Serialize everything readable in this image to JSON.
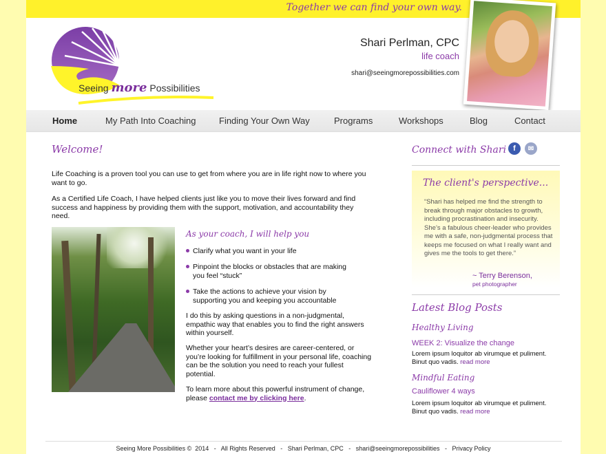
{
  "header": {
    "tagline": "Together we can find your own way.",
    "logo": {
      "word1": "Seeing",
      "word2": "more",
      "word3": "Possibilities"
    },
    "name": "Shari Perlman, CPC",
    "title": "life coach",
    "email": "shari@seeingmorepossibilities.com"
  },
  "nav": {
    "items": [
      {
        "label": "Home",
        "active": true
      },
      {
        "label": "My Path Into Coaching"
      },
      {
        "label": "Finding Your Own Way"
      },
      {
        "label": "Programs"
      },
      {
        "label": "Workshops"
      },
      {
        "label": "Blog"
      },
      {
        "label": "Contact"
      }
    ]
  },
  "main": {
    "heading": "Welcome!",
    "p1": "Life Coaching is a proven tool you can use to get from where you are in life right now to where you want to go.",
    "p2": "As a Certified Life Coach, I have helped clients just like you to move their lives forward and find success and happiness by providing them with the support, motivation, and accountability they need.",
    "coach_heading": "As your coach, I will help you",
    "bullets": [
      "Clarify what you want in your life",
      "Pinpoint the blocks or obstacles that are making you feel “stuck”",
      "Take the actions to achieve your vision by supporting you and keeping you accountable"
    ],
    "p3": "I do this by asking questions in a non-judgmental, empathic way that enables you to find the right answers within yourself.",
    "p4": "Whether your heart’s desires are career-centered, or you’re looking for fulfillment in your personal life, coaching can be the solution you need to reach your fullest potential.",
    "p5_text": "To learn more about this powerful instrument of change, please ",
    "p5_link": "contact me by clicking here",
    "p5_end": "."
  },
  "sidebar": {
    "connect": "Connect with Shari",
    "clients_heading": "The client's perspective...",
    "quote": "“Shari has helped me find the strength to break through major obstacles to growth, including procrastination and insecurity.  She’s a fabulous cheer-leader who provides me with a safe, non-judgmental process that keeps me focused on what I really want and gives me the tools to get there.”",
    "quote_author": "~ Terry Berenson,",
    "quote_role": "pet photographer",
    "blog_heading": "Latest Blog Posts",
    "posts": [
      {
        "category": "Healthy Living",
        "title": "WEEK 2: Visualize the change",
        "excerpt": "Lorem ipsum loquitor ab virumque et puliment. Binut quo vadis.",
        "more": "read more"
      },
      {
        "category": "Mindful Eating",
        "title": "Cauliflower 4 ways",
        "excerpt": "Lorem ipsum loquitor ab virumque et puliment. Binut quo vadis.",
        "more": "read more"
      }
    ]
  },
  "footer": {
    "text": "Seeing More Possibilities ©  2014   -   All Rights Reserved   -   Shari Perlman, CPC   -   shari@seeingmorepossibilities   -   Privacy Policy"
  },
  "colors": {
    "accent": "#8b3aa8",
    "banner": "#fff12b",
    "background": "#fffcb0"
  }
}
